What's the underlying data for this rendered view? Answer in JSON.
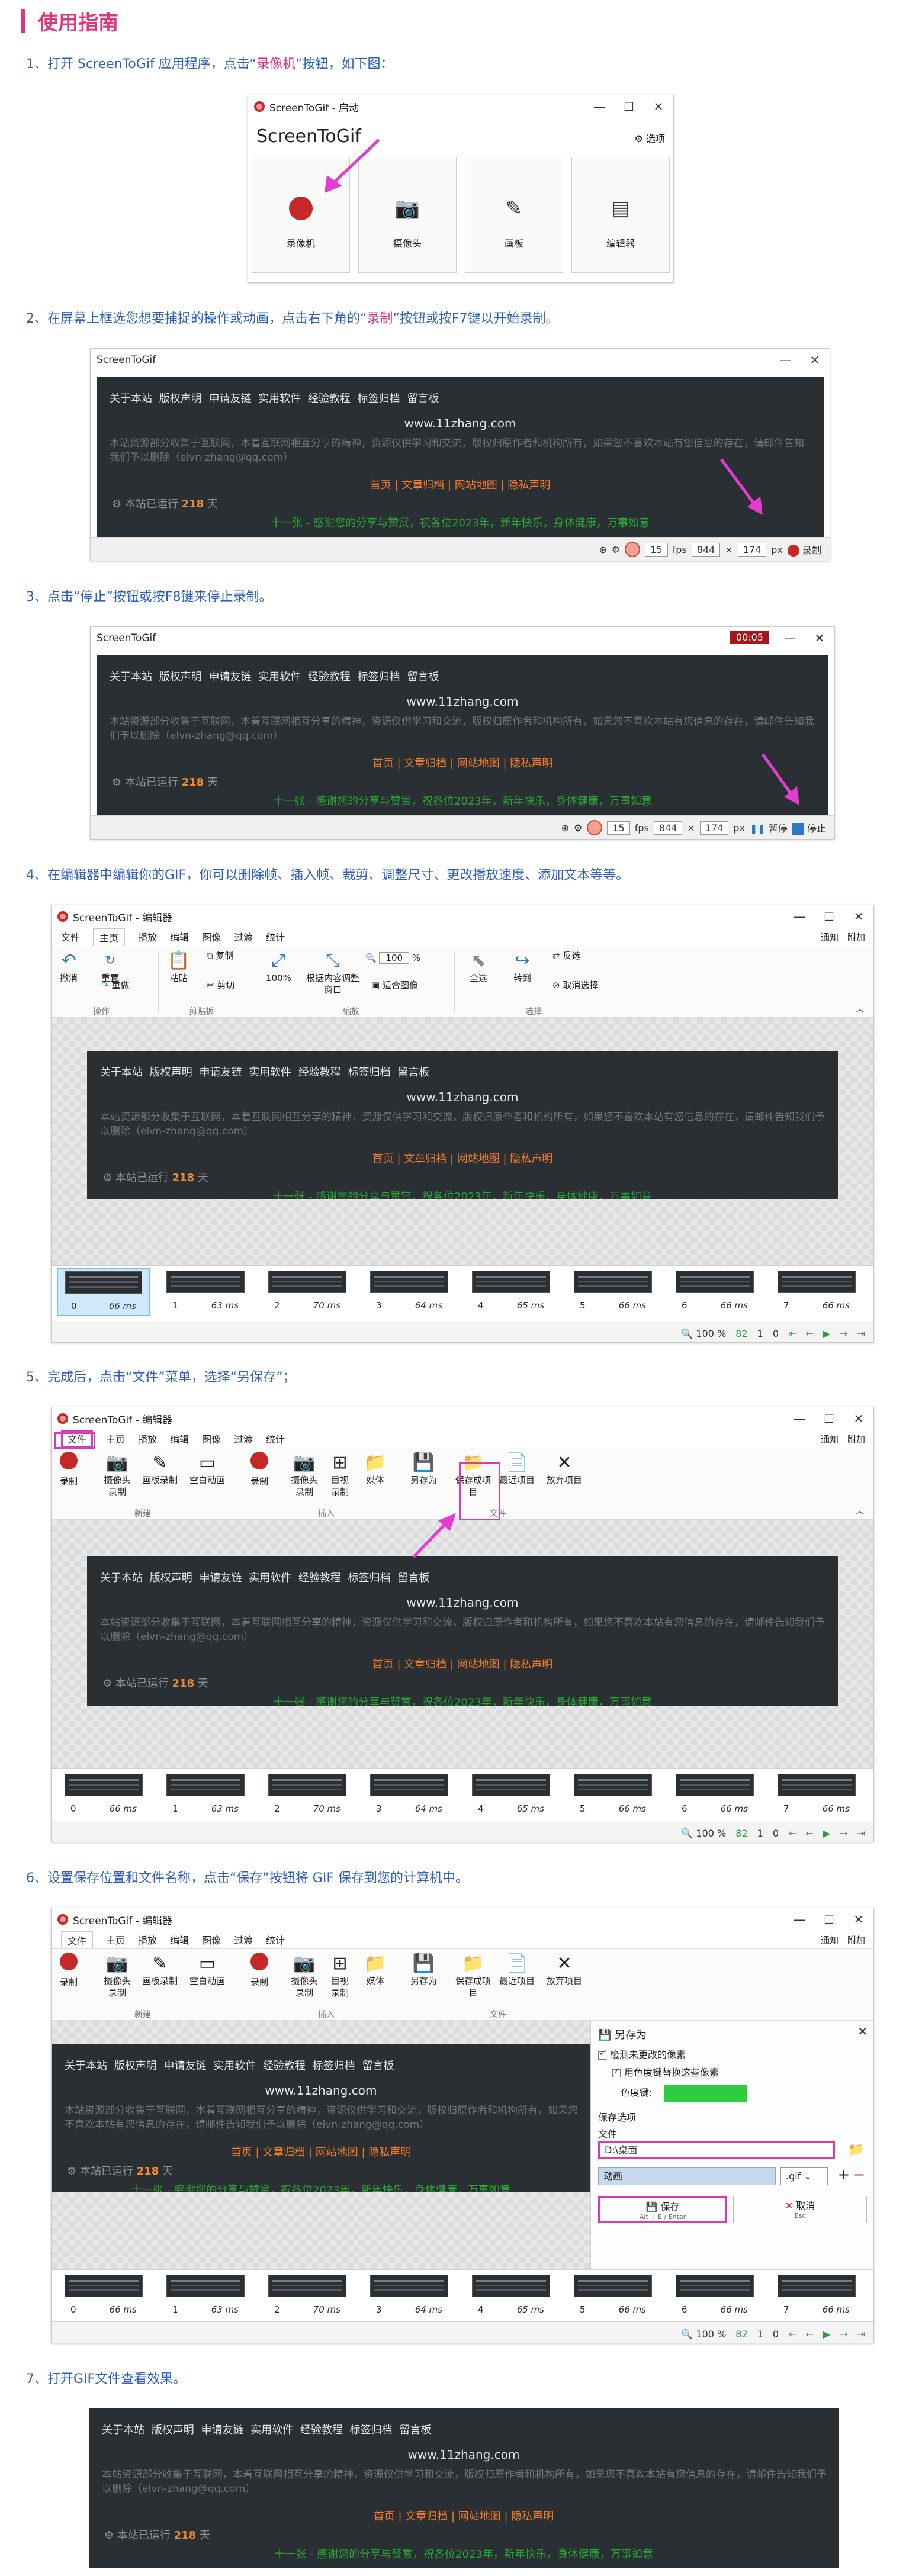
{
  "heading": "使用指南",
  "steps": {
    "s1_pre": "1、打开 ScreenToGif 应用程序，点击“",
    "s1_hl": "录像机",
    "s1_post": "”按钮，如下图：",
    "s2_pre": "2、在屏幕上框选您想要捕捉的操作或动画，点击右下角的“",
    "s2_hl": "录制",
    "s2_post": "”按钮或按F7键以开始录制。",
    "s3": "3、点击“停止”按钮或按F8键来停止录制。",
    "s4": "4、在编辑器中编辑你的GIF，你可以删除帧、插入帧、裁剪、调整尺寸、更改播放速度、添加文本等等。",
    "s5": "5、完成后，点击“文件”菜单，选择“另保存”；",
    "s6": "6、设置保存位置和文件名称，点击“保存”按钮将 GIF 保存到您的计算机中。",
    "s7": "7、打开GIF文件查看效果。"
  },
  "launcher": {
    "window_title": "ScreenToGif - 启动",
    "app_name": "ScreenToGif",
    "options_label": "选项",
    "tiles": [
      {
        "label": "录像机",
        "icon": "recorder-icon"
      },
      {
        "label": "摄像头",
        "icon": "camera-icon"
      },
      {
        "label": "画板",
        "icon": "board-icon"
      },
      {
        "label": "编辑器",
        "icon": "editor-icon"
      }
    ]
  },
  "recorder": {
    "window_title": "ScreenToGif",
    "fps_value": "15",
    "fps_unit": "fps",
    "width": "844",
    "height": "174",
    "size_unit": "px",
    "record_label": "录制",
    "timer": "00:05",
    "pause_label": "暂停",
    "stop_label": "停止"
  },
  "site": {
    "nav": "关于本站 版权声明 申请友链 实用软件 经验教程 标签归档 留言板",
    "domain": "www.11zhang.com",
    "desc": "本站资源部分收集于互联网，本着互联网相互分享的精神，资源仅供学习和交流，版权归原作者和机构所有，如果您不喜欢本站有您信息的存在，请邮件告知我们予以删除（elvn-zhang@qq.com）",
    "links": "首页 | 文章归档 | 网站地图 | 隐私声明",
    "run_pre": "本站已运行",
    "run_days": "218",
    "run_post": "天",
    "footer": "十一张 - 感谢您的分享与赞赏，祝各位2023年，新年快乐，身体健康，万事如意"
  },
  "editor": {
    "window_title": "ScreenToGif - 编辑器",
    "tabs": [
      "文件",
      "主页",
      "播放",
      "编辑",
      "图像",
      "过渡",
      "统计"
    ],
    "notify": "通知",
    "attach": "附加",
    "home_ribbon": [
      {
        "label": "撤消",
        "icon": "undo-icon"
      },
      {
        "label": "重置",
        "icon": "reset-icon"
      },
      {
        "label": "重做",
        "icon": "redo-icon"
      },
      {
        "label": "粘贴",
        "icon": "paste-icon"
      },
      {
        "label": "复制",
        "icon": "copy-icon"
      },
      {
        "label": "剪切",
        "icon": "cut-icon"
      },
      {
        "label": "100%",
        "icon": "zoom100-icon"
      },
      {
        "label": "根据内容调整窗口",
        "icon": "fit-window-icon"
      },
      {
        "label": "适合图像",
        "icon": "fit-image-icon"
      },
      {
        "label": "全选",
        "icon": "select-all-icon"
      },
      {
        "label": "转到",
        "icon": "goto-icon"
      },
      {
        "label": "反选",
        "icon": "invert-icon"
      },
      {
        "label": "取消选择",
        "icon": "deselect-icon"
      }
    ],
    "home_groups": [
      "操作",
      "剪贴板",
      "缩放",
      "选择"
    ],
    "zoom_value": "100",
    "file_ribbon": [
      {
        "label": "录制",
        "icon": "record-icon"
      },
      {
        "label": "摄像头录制",
        "icon": "webcam-icon"
      },
      {
        "label": "画板录制",
        "icon": "board-icon"
      },
      {
        "label": "空白动画",
        "icon": "blank-icon"
      },
      {
        "label": "录制",
        "icon": "record-icon"
      },
      {
        "label": "摄像头录制",
        "icon": "webcam-icon"
      },
      {
        "label": "目视录制",
        "icon": "sight-icon"
      },
      {
        "label": "媒体",
        "icon": "media-icon"
      },
      {
        "label": "另存为",
        "icon": "save-as-icon"
      },
      {
        "label": "保存成项目",
        "icon": "save-project-icon"
      },
      {
        "label": "最近项目",
        "icon": "recent-icon"
      },
      {
        "label": "放弃项目",
        "icon": "discard-icon"
      }
    ],
    "file_groups": [
      "新建",
      "插入",
      "文件"
    ],
    "frames": [
      {
        "n": "0",
        "d": "66 ms"
      },
      {
        "n": "1",
        "d": "63 ms"
      },
      {
        "n": "2",
        "d": "70 ms"
      },
      {
        "n": "3",
        "d": "64 ms"
      },
      {
        "n": "4",
        "d": "65 ms"
      },
      {
        "n": "5",
        "d": "66 ms"
      },
      {
        "n": "6",
        "d": "66 ms"
      },
      {
        "n": "7",
        "d": "66 ms"
      }
    ],
    "status": {
      "zoom": "100",
      "pct": "%",
      "count": "82",
      "sel": "1",
      "extra": "0"
    }
  },
  "save": {
    "title": "另存为",
    "opt1": "检测未更改的像素",
    "opt2": "用色度键替换这些像素",
    "chroma_label": "色度键:",
    "chroma_color": "#2ecc40",
    "section_options": "保存选项",
    "section_file": "文件",
    "path": "D:\\桌面",
    "filename": "动画",
    "ext": ".gif",
    "save_label": "保存",
    "save_hint": "Alt + E / Enter",
    "cancel_label": "取消",
    "cancel_hint": "Esc"
  },
  "colors": {
    "accent": "#e0357b",
    "step": "#2f5fbf",
    "highlight": "#d83ab8"
  }
}
